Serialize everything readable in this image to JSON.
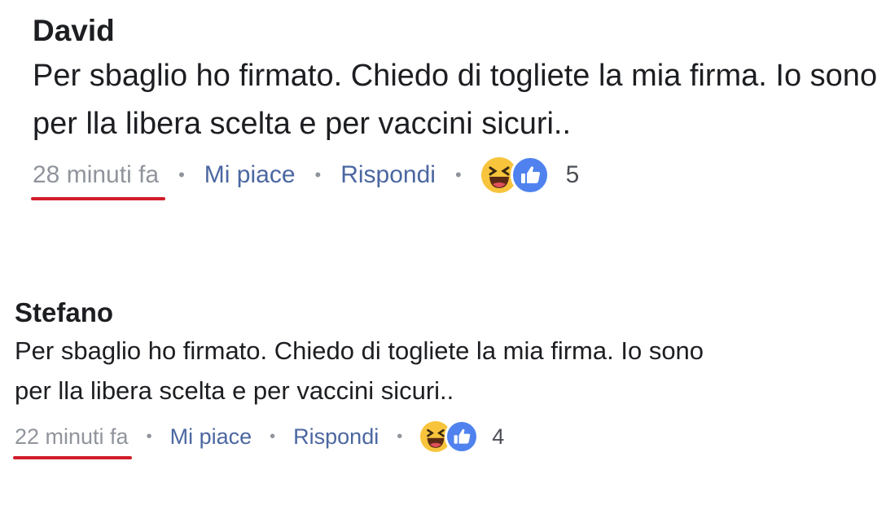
{
  "comments": [
    {
      "author": "David",
      "text": "Per sbaglio ho firmato. Chiedo di togliete la mia firma. Io sono per lla libera scelta e per vaccini sicuri..",
      "time": "28 minuti fa",
      "like_label": "Mi piace",
      "reply_label": "Rispondi",
      "reaction_count": "5",
      "reactions": [
        "haha-icon",
        "like-icon"
      ]
    },
    {
      "author": "Stefano",
      "text": "Per sbaglio ho firmato. Chiedo di togliete la mia firma. Io sono per lla libera scelta e per vaccini sicuri..",
      "time": "22 minuti fa",
      "like_label": "Mi piace",
      "reply_label": "Rispondi",
      "reaction_count": "4",
      "reactions": [
        "haha-icon",
        "like-icon"
      ]
    }
  ],
  "separator": "•",
  "colors": {
    "underline": "#d01e2a",
    "link": "#4b67a1",
    "like_blue": "#4f82ee",
    "haha_yellow": "#f7c43c"
  }
}
